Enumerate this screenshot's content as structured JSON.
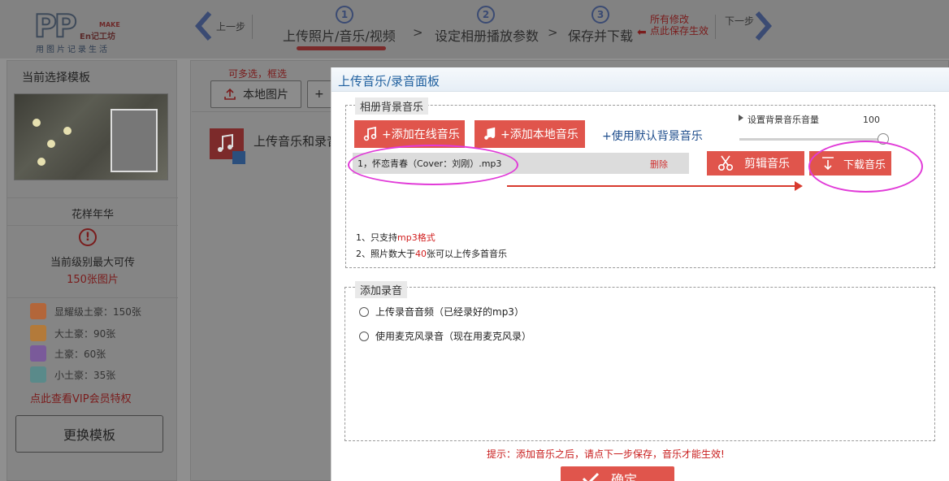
{
  "header": {
    "logo": {
      "mark": "PP",
      "make": "MAKE",
      "maker": "En记工坊",
      "tagline": "用图片记录生活"
    },
    "prev_label": "上一步",
    "next_label": "下一步",
    "steps": [
      {
        "num": "1",
        "label": "上传照片/音乐/视频"
      },
      {
        "num": "2",
        "label": "设定相册播放参数"
      },
      {
        "num": "3",
        "label": "保存并下载"
      }
    ],
    "step_separator": ">",
    "save_note_line1": "所有修改",
    "save_note_line2": "点此保存生效"
  },
  "sidebar": {
    "title": "当前选择模板",
    "template_name": "花样年华",
    "max_text": "当前级别最大可传",
    "max_value": "150张图片",
    "tiers": [
      {
        "label": "显耀级土豪：150张",
        "color": "#b3663a"
      },
      {
        "label": "大土豪：90张",
        "color": "#b37a3a"
      },
      {
        "label": "土豪：60张",
        "color": "#7a5a9a"
      },
      {
        "label": "小土豪：35张",
        "color": "#5a8a8a"
      }
    ],
    "vip_link": "点此查看VIP会员特权",
    "change_button": "更换模板"
  },
  "main": {
    "multi_hint": "可多选，框选",
    "local_button": "本地图片",
    "plus_button": "+",
    "music_tile_label": "上传音乐和录音"
  },
  "modal": {
    "title": "上传音乐/录音面板",
    "bg_music": {
      "legend": "相册背景音乐",
      "add_online": "+添加在线音乐",
      "add_local": "+添加本地音乐",
      "use_default": "+使用默认背景音乐",
      "volume_label": "设置背景音乐音量",
      "volume_value": "100",
      "volume_level": 100,
      "song": "1，怀恋青春（Cover：刘刚）.mp3",
      "delete": "删除",
      "cut_button": "剪辑音乐",
      "download_button": "下载音乐",
      "notes": [
        {
          "pre": "1、只支持",
          "hl": "mp3格式",
          "post": ""
        },
        {
          "pre": "2、照片数大于",
          "hl": "40",
          "post": "张可以上传多首音乐"
        }
      ]
    },
    "recording": {
      "legend": "添加录音",
      "options": [
        "上传录音音频（已经录好的mp3）",
        "使用麦克风录音（现在用麦克风录）"
      ]
    },
    "footer_tip": "提示：添加音乐之后，请点下一步保存，音乐才能生效!",
    "confirm": "确定"
  },
  "colors": {
    "accent_red": "#e0554c",
    "annotation_magenta": "#e13bd8",
    "link_blue": "#1e4d8c",
    "title_blue": "#1f5f9e"
  }
}
